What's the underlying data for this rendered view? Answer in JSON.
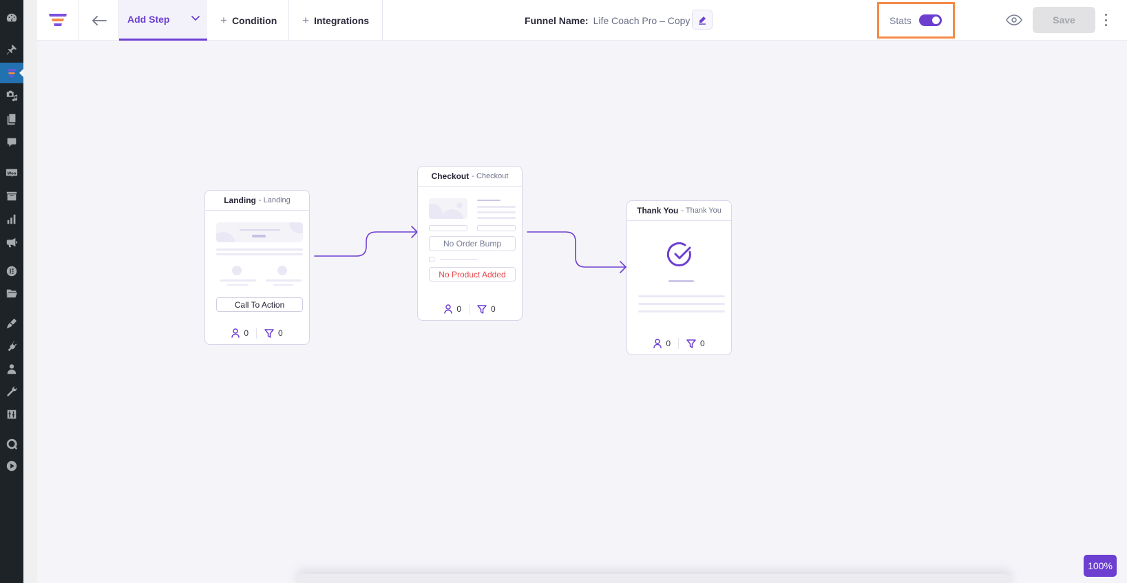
{
  "wp_sidebar": {
    "items": [
      {
        "icon": "dashboard-icon",
        "active": false
      },
      {
        "icon": "pin-icon",
        "active": false
      },
      {
        "icon": "funnel-icon",
        "active": true
      },
      {
        "icon": "media-icon",
        "active": false
      },
      {
        "icon": "pages-icon",
        "active": false
      },
      {
        "icon": "comments-icon",
        "active": false
      },
      {
        "icon": "woo-icon",
        "label": "Woo",
        "active": false
      },
      {
        "icon": "archive-icon",
        "active": false
      },
      {
        "icon": "analytics-icon",
        "active": false
      },
      {
        "icon": "megaphone-icon",
        "active": false
      },
      {
        "icon": "elementor-icon",
        "active": false
      },
      {
        "icon": "folder-icon",
        "active": false
      },
      {
        "icon": "appearance-icon",
        "active": false
      },
      {
        "icon": "plugins-icon",
        "active": false
      },
      {
        "icon": "users-icon",
        "active": false
      },
      {
        "icon": "tools-icon",
        "active": false
      },
      {
        "icon": "settings-icon",
        "active": false
      },
      {
        "icon": "q-icon",
        "active": false
      },
      {
        "icon": "play-icon",
        "active": false
      }
    ]
  },
  "toolbar": {
    "back_icon": "arrow-left-icon",
    "add_step_label": "Add Step",
    "condition_label": "Condition",
    "integrations_label": "Integrations",
    "plus_glyph": "+",
    "funnel_name_label": "Funnel Name:",
    "funnel_name_value": "Life Coach Pro – Copy",
    "stats_label": "Stats",
    "stats_enabled": true,
    "save_label": "Save",
    "save_disabled": true
  },
  "steps": [
    {
      "title": "Landing",
      "type_suffix": "- Landing",
      "button_label": "Call To Action",
      "visitors": "0",
      "conversions": "0"
    },
    {
      "title": "Checkout",
      "type_suffix": "- Checkout",
      "order_bump_label": "No Order Bump",
      "product_label": "No Product Added",
      "visitors": "0",
      "conversions": "0"
    },
    {
      "title": "Thank You",
      "type_suffix": "- Thank You",
      "visitors": "0",
      "conversions": "0"
    }
  ],
  "zoom_level": "100%",
  "colors": {
    "accent": "#6c3fd1",
    "highlight_border": "#f48a45",
    "error_text": "#e5484d",
    "wp_sidebar_bg": "#1d2327",
    "wp_active_bg": "#2271b1"
  }
}
